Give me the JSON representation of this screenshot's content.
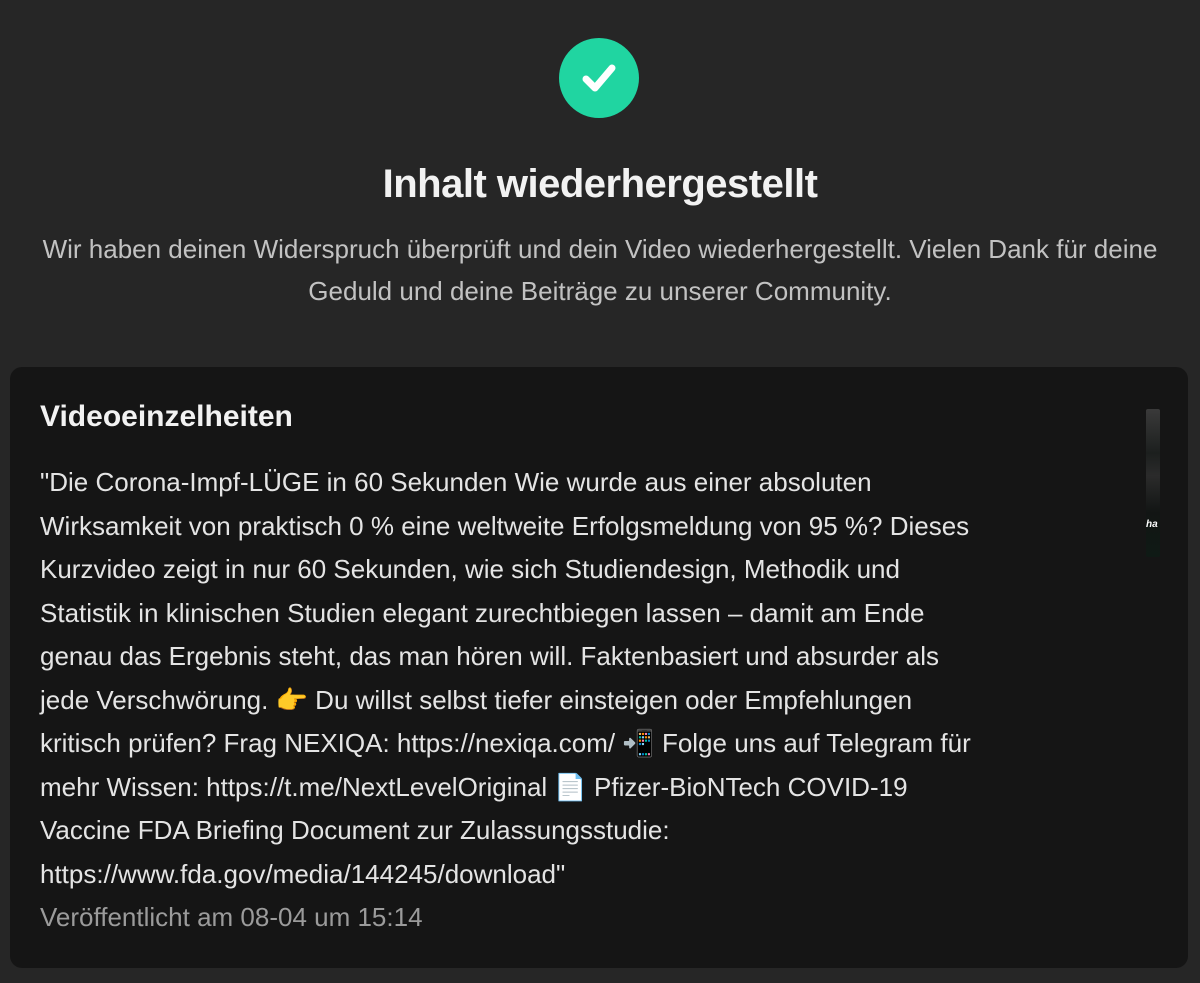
{
  "status": {
    "icon": "check-circle-icon",
    "accent_color": "#20d5a1",
    "title": "Inhalt wiederhergestellt",
    "message": "Wir haben deinen Widerspruch überprüft und dein Video wiederhergestellt. Vielen Dank für deine Geduld und deine Beiträge zu unserer Community."
  },
  "video_details": {
    "heading": "Videoeinzelheiten",
    "description": "\"Die Corona-Impf-LÜGE in 60 Sekunden Wie wurde aus einer absoluten\nWirksamkeit von praktisch 0 % eine weltweite Erfolgsmeldung von 95 %? Dieses\nKurzvideo zeigt in nur 60 Sekunden, wie sich Studiendesign, Methodik und\nStatistik in klinischen Studien elegant zurechtbiegen lassen – damit am Ende\ngenau das Ergebnis steht, das man hören will. Faktenbasiert und absurder als\njede Verschwörung. 👉 Du willst selbst tiefer einsteigen oder Empfehlungen\nkritisch prüfen? Frag NEXIQA: https://nexiqa.com/ 📲 Folge uns auf Telegram für\nmehr Wissen: https://t.me/NextLevelOriginal 📄 Pfizer-BioNTech COVID-19\nVaccine FDA Briefing Document zur Zulassungsstudie:\nhttps://www.fda.gov/media/144245/download\"",
    "published": "Veröffentlicht am 08-04 um 15:14",
    "thumbnail_text": "ha"
  }
}
